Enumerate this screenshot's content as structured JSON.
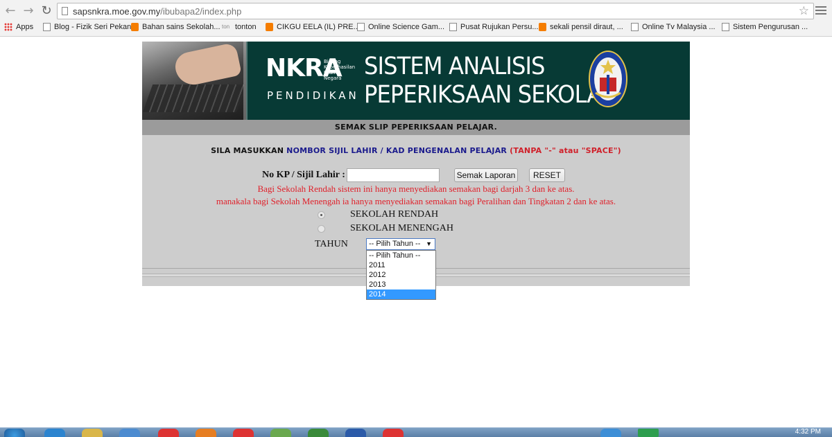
{
  "browser": {
    "url_host": "sapsnkra.moe.gov.my",
    "url_path": "/ibubapa2/index.php",
    "bookmarks": [
      {
        "label": "Apps",
        "icon": "apps-icon"
      },
      {
        "label": "Blog - Fizik Seri Pekan",
        "icon": "page-icon"
      },
      {
        "label": "Bahan sains Sekolah...",
        "icon": "blogger-icon"
      },
      {
        "label": "tonton",
        "icon": "tonton-icon"
      },
      {
        "label": "CIKGU EELA (IL) PRE...",
        "icon": "blogger-icon"
      },
      {
        "label": "Online Science Gam...",
        "icon": "page-icon"
      },
      {
        "label": "Pusat Rujukan Persu...",
        "icon": "page-icon"
      },
      {
        "label": "sekali pensil diraut, ...",
        "icon": "blogger-icon"
      },
      {
        "label": "Online Tv Malaysia ...",
        "icon": "page-icon"
      },
      {
        "label": "Sistem Pengurusan ...",
        "icon": "page-icon"
      }
    ]
  },
  "banner": {
    "logo_main": "NKRA",
    "logo_sub": [
      "Bidang",
      "Keberhasilan",
      "Utama",
      "Negara"
    ],
    "logo_bottom": "PENDIDIKAN",
    "title_line1": "SISTEM ANALISIS",
    "title_line2": "PEPERIKSAAN SEKOLAH"
  },
  "section_title": "SEMAK SLIP PEPERIKSAAN PELAJAR.",
  "instruction": {
    "part1": "SILA MASUKKAN ",
    "part2": "NOMBOR SIJIL LAHIR / KAD PENGENALAN PELAJAR ",
    "part3": "(TANPA \"-\" atau \"SPACE\")"
  },
  "form": {
    "kp_label": "No KP / Sijil Lahir :",
    "kp_value": "",
    "semak_button": "Semak Laporan",
    "reset_button": "RESET",
    "note1": "Bagi Sekolah Rendah sistem ini hanya menyediakan semakan bagi darjah 3 dan ke atas.",
    "note2": "manakala bagi Sekolah Menengah ia hanya menyediakan semakan bagi Peralihan dan Tingkatan 2 dan ke atas.",
    "radio_rendah": "SEKOLAH RENDAH",
    "radio_menengah": "SEKOLAH MENENGAH",
    "radio_selected": "SEKOLAH RENDAH",
    "tahun_label": "TAHUN",
    "tahun_selected": "-- Pilih Tahun --",
    "tahun_options": [
      "-- Pilih Tahun --",
      "2011",
      "2012",
      "2013",
      "2014"
    ],
    "tahun_highlighted": "2014"
  },
  "taskbar": {
    "clock": "4:32 PM"
  },
  "colors": {
    "banner_bg": "#073a35",
    "section_bg": "#9b9b9b",
    "form_bg": "#cdcdcd",
    "instruction_blue": "#1a1a8c",
    "note_red": "#e0202a",
    "dropdown_highlight": "#3399ff"
  }
}
